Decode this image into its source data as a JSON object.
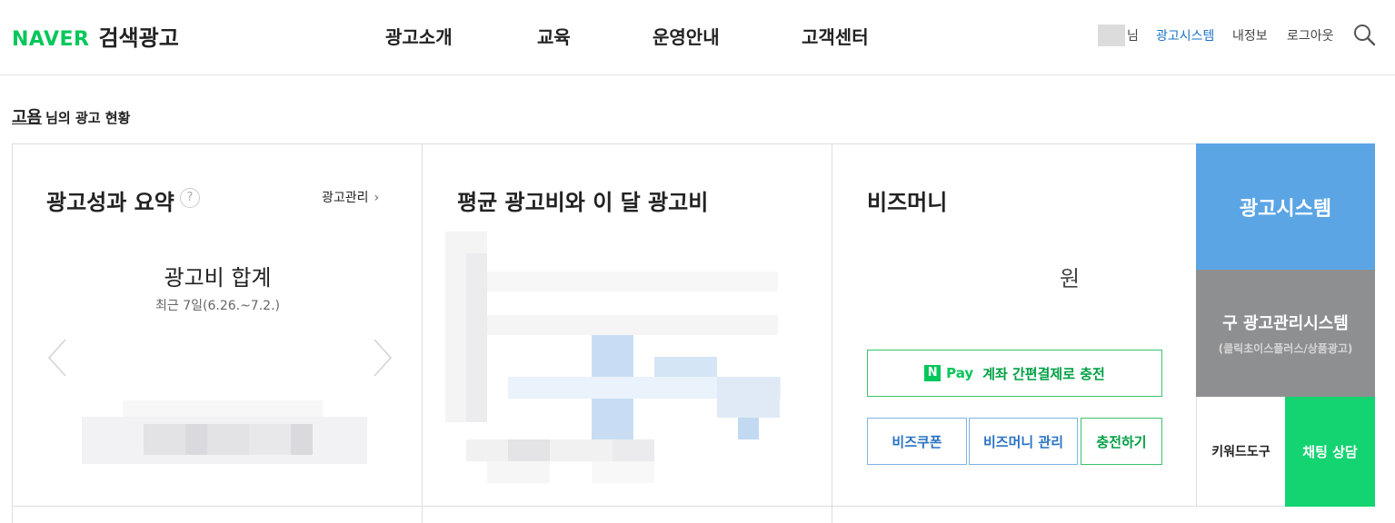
{
  "header": {
    "logo_brand": "NAVER",
    "logo_sub": "검색광고",
    "nav": [
      "광고소개",
      "교육",
      "운영안내",
      "고객센터"
    ],
    "user_suffix": "님",
    "links": {
      "ad_system": "광고시스템",
      "my_info": "내정보",
      "logout": "로그아웃"
    },
    "search_icon": "search-icon",
    "accent_color": "#1a73c8"
  },
  "greeting": {
    "user_name": "고욤",
    "suffix": "님의 광고 현황"
  },
  "performance": {
    "title": "광고성과 요약",
    "help_icon": "?",
    "manage_label": "광고관리",
    "sum_title": "광고비 합계",
    "period": "최근 7일(6.26.~7.2.)"
  },
  "avg_cost": {
    "title": "평균 광고비와 이 달 광고비"
  },
  "bizmoney": {
    "title": "비즈머니",
    "won": "원",
    "npay_logo": "N",
    "npay_word": "Pay",
    "npay_label": "계좌 간편결제로 충전",
    "coupon_label": "비즈쿠폰",
    "manage_label": "비즈머니 관리",
    "charge_label": "충전하기"
  },
  "side": {
    "ad_system": "광고시스템",
    "old_system": "구 광고관리시스템",
    "old_system_sub": "(클릭초이스플러스/상품광고)",
    "keyword_tool": "키워드도구",
    "chat": "채팅 상담"
  },
  "colors": {
    "brand_green": "#03c75a",
    "side_blue": "#5ba5e5",
    "side_gray": "#8e8f91",
    "side_green": "#13d471"
  }
}
